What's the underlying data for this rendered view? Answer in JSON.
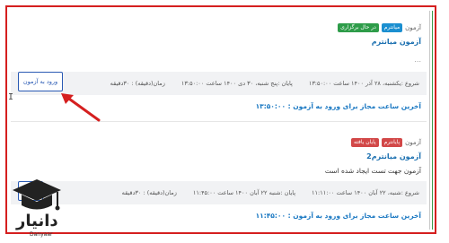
{
  "exam1": {
    "type_label": "آزمون",
    "badge_left": "میانترم",
    "badge_right": "در حال برگزاری",
    "title": "آزمون میانترم",
    "description": "...",
    "start": "شروع :یکشنبه، ۲۸ آذر ۱۴۰۰ ساعت ۱۳:۵۰:۰۰",
    "end": "پایان :پنج شنبه، ۳۰ دی ۱۴۰۰ ساعت ۱۳:۵۰:۰۰",
    "duration": "زمان(دقیقه) : ۳۰دقیقه",
    "enter_button": "ورود به آزمون",
    "deadline": "آخرین ساعت مجاز برای ورود به آزمون : ۱۳:۵۰:۰۰"
  },
  "exam2": {
    "type_label": "آزمون",
    "badge_left": "پایانترم",
    "badge_right": "پایان یافته",
    "title": "آزمون میانترم2",
    "description": "آزمون جهت تست ایجاد شده است",
    "start": "شروع :شنبه، ۲۲ آبان ۱۴۰۰ ساعت ۱۱:۱۱:۰۰",
    "end": "پایان :شنبه ۲۲ آبان ۱۴۰۰ ساعت ۱۱:۴۵:۰۰",
    "duration": "زمان(دقیقه) : ۳۰دقیقه",
    "result_button": "نتیجه",
    "deadline": "آخرین ساعت مجاز برای ورود به آزمون : ۱۱:۴۵:۰۰"
  },
  "watermark": {
    "brand": "دانیار",
    "brand_sub": "Danyaar"
  },
  "colors": {
    "frame": "#d51f1f",
    "link": "#1a78c2",
    "badge_green": "#2e9c49",
    "badge_blue": "#1b8fd0",
    "badge_red": "#d24848"
  }
}
